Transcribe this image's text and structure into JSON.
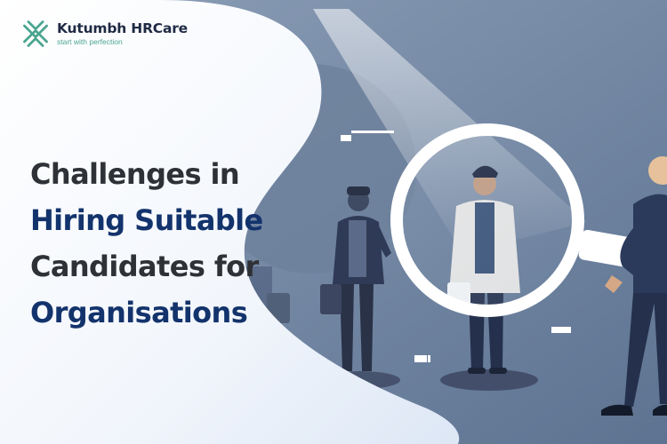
{
  "brand": {
    "name": "Kutumbh HRCare",
    "tagline": "start with perfection",
    "colors": {
      "primary": "#1f2a44",
      "accent": "#4aa58f"
    }
  },
  "headline": {
    "line1": "Challenges in",
    "line2": "Hiring Suitable",
    "line3": "Candidates for",
    "line4": "Organisations",
    "colors": {
      "dark": "#2e3136",
      "highlight": "#13336c"
    }
  },
  "illustration": {
    "description_icons": [
      "magnifier-icon",
      "businessman-figure",
      "briefcase-icon",
      "clipboard-icon"
    ]
  }
}
